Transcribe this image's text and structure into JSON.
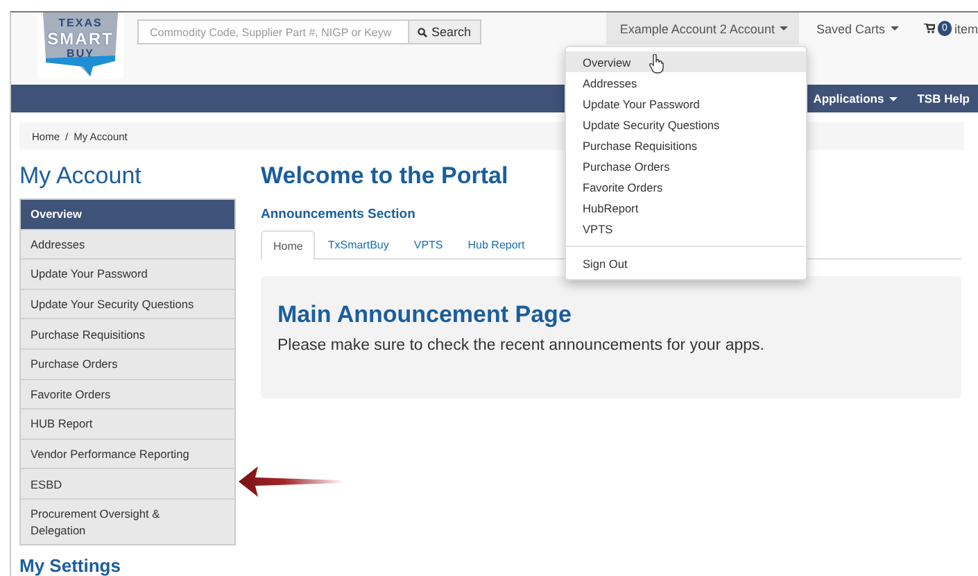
{
  "header": {
    "logo": [
      "TEXAS",
      "SMART",
      "BUY"
    ],
    "search": {
      "placeholder": "Commodity Code, Supplier Part #, NIGP or Keyw",
      "button": "Search"
    },
    "account_menu": {
      "label": "Example Account 2 Account",
      "expanded": true
    },
    "saved_carts": "Saved Carts",
    "cart": {
      "count": "0",
      "label": "item"
    }
  },
  "navbar": {
    "items": [
      {
        "label": "Applications",
        "caret": true
      },
      {
        "label": "TSB Help",
        "caret": false
      }
    ]
  },
  "breadcrumb": {
    "items": [
      "Home",
      "My Account"
    ],
    "separator": "/"
  },
  "sidebar": {
    "title": "My Account",
    "items": [
      {
        "label": "Overview",
        "selected": true
      },
      {
        "label": "Addresses",
        "selected": false
      },
      {
        "label": "Update Your Password",
        "selected": false
      },
      {
        "label": "Update Your Security Questions",
        "selected": false
      },
      {
        "label": "Purchase Requisitions",
        "selected": false
      },
      {
        "label": "Purchase Orders",
        "selected": false
      },
      {
        "label": "Favorite Orders",
        "selected": false
      },
      {
        "label": "HUB Report",
        "selected": false
      },
      {
        "label": "Vendor Performance Reporting",
        "selected": false
      },
      {
        "label": "ESBD",
        "selected": false
      },
      {
        "label": "Procurement Oversight & Delegation",
        "selected": false
      }
    ],
    "section_title": "My Settings"
  },
  "main": {
    "title": "Welcome to the Portal",
    "section": "Announcements Section",
    "tabs": [
      {
        "label": "Home",
        "selected": true
      },
      {
        "label": "TxSmartBuy",
        "selected": false
      },
      {
        "label": "VPTS",
        "selected": false
      },
      {
        "label": "Hub Report",
        "selected": false
      }
    ],
    "panel": {
      "title": "Main Announcement Page",
      "text": "Please make sure to check the recent announcements for your apps."
    }
  },
  "account_dropdown": {
    "items": [
      {
        "label": "Overview",
        "highlighted": true
      },
      {
        "label": "Addresses",
        "highlighted": false
      },
      {
        "label": "Update Your Password",
        "highlighted": false
      },
      {
        "label": "Update Security Questions",
        "highlighted": false
      },
      {
        "label": "Purchase Requisitions",
        "highlighted": false
      },
      {
        "label": "Purchase Orders",
        "highlighted": false
      },
      {
        "label": "Favorite Orders",
        "highlighted": false
      },
      {
        "label": "HubReport",
        "highlighted": false
      },
      {
        "label": "VPTS",
        "highlighted": false
      }
    ],
    "footer_item": "Sign Out"
  }
}
